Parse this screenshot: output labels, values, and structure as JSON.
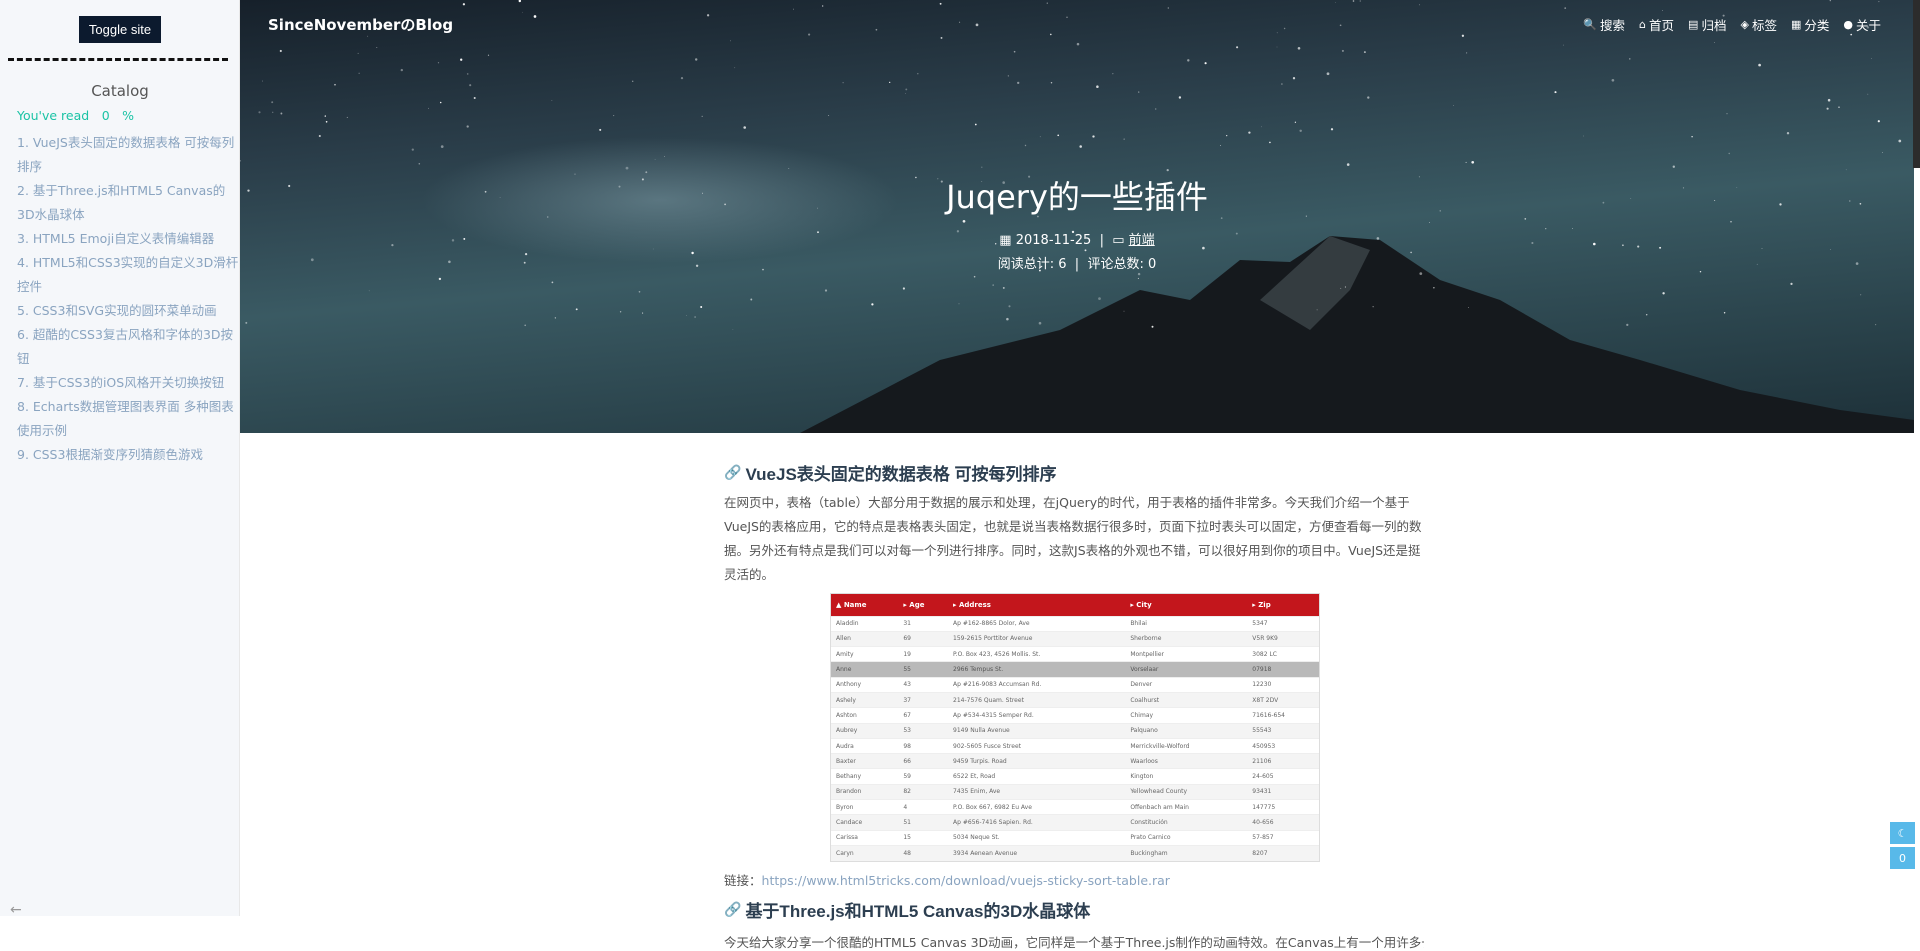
{
  "sidebar": {
    "toggle_label": "Toggle site",
    "catalog_title": "Catalog",
    "read_progress": "You've read　0　%",
    "toc": [
      "1. VueJS表头固定的数据表格 可按每列排序",
      "2. 基于Three.js和HTML5 Canvas的3D水晶球体",
      "3. HTML5 Emoji自定义表情编辑器",
      "4. HTML5和CSS3实现的自定义3D滑杆控件",
      "5. CSS3和SVG实现的圆环菜单动画",
      "6. 超酷的CSS3复古风格和字体的3D按钮",
      "7. 基于CSS3的iOS风格开关切换按钮",
      "8. Echarts数据管理图表界面 多种图表使用示例",
      "9. CSS3根据渐变序列猜颜色游戏"
    ]
  },
  "header": {
    "brand": "SinceNovemberのBlog",
    "nav": [
      {
        "icon": "search-icon",
        "glyph": "🔍",
        "label": "搜索"
      },
      {
        "icon": "home-icon",
        "glyph": "⌂",
        "label": "首页"
      },
      {
        "icon": "archive-icon",
        "glyph": "▤",
        "label": "归档"
      },
      {
        "icon": "tag-icon",
        "glyph": "◈",
        "label": "标签"
      },
      {
        "icon": "category-icon",
        "glyph": "▦",
        "label": "分类"
      },
      {
        "icon": "user-icon",
        "glyph": "●",
        "label": "关于"
      }
    ]
  },
  "post": {
    "title": "Juqery的一些插件",
    "date": "2018-11-25",
    "category": "前端",
    "views_label": "阅读总计: 6",
    "comments_label": "评论总数: 0"
  },
  "section1": {
    "heading": "VueJS表头固定的数据表格 可按每列排序",
    "paragraph": "在网页中，表格（table）大部分用于数据的展示和处理，在jQuery的时代，用于表格的插件非常多。今天我们介绍一个基于VueJS的表格应用，它的特点是表格表头固定，也就是说当表格数据行很多时，页面下拉时表头可以固定，方便查看每一列的数据。另外还有特点是我们可以对每一个列进行排序。同时，这款JS表格的外观也不错，可以很好用到你的项目中。VueJS还是挺灵活的。",
    "table": {
      "headers": [
        "▲ Name",
        "▸ Age",
        "▸ Address",
        "▸ City",
        "▸ Zip"
      ],
      "rows": [
        [
          "Aladdin",
          "31",
          "Ap #162-8865 Dolor, Ave",
          "Bhilai",
          "5347"
        ],
        [
          "Allen",
          "69",
          "159-2615 Porttitor Avenue",
          "Sherborne",
          "V5R 9K9"
        ],
        [
          "Amity",
          "19",
          "P.O. Box 423, 4526 Mollis. St.",
          "Montpellier",
          "3082 LC"
        ],
        [
          "Anne",
          "55",
          "2966 Tempus St.",
          "Vorselaar",
          "07918"
        ],
        [
          "Anthony",
          "43",
          "Ap #216-9083 Accumsan Rd.",
          "Denver",
          "12230"
        ],
        [
          "Ashely",
          "37",
          "214-7576 Quam. Street",
          "Coalhurst",
          "X8T 2DV"
        ],
        [
          "Ashton",
          "67",
          "Ap #534-4315 Semper Rd.",
          "Chimay",
          "71616-654"
        ],
        [
          "Aubrey",
          "53",
          "9149 Nulla Avenue",
          "Palquano",
          "55543"
        ],
        [
          "Audra",
          "98",
          "902-5605 Fusce Street",
          "Merrickville-Wolford",
          "450953"
        ],
        [
          "Baxter",
          "66",
          "9459 Turpis. Road",
          "Waarloos",
          "21106"
        ],
        [
          "Bethany",
          "59",
          "6522 Et, Road",
          "Kington",
          "24-605"
        ],
        [
          "Brandon",
          "82",
          "7435 Enim, Ave",
          "Yellowhead County",
          "93431"
        ],
        [
          "Byron",
          "4",
          "P.O. Box 667, 6982 Eu Ave",
          "Offenbach am Main",
          "147775"
        ],
        [
          "Candace",
          "51",
          "Ap #656-7416 Sapien. Rd.",
          "Constitución",
          "40-656"
        ],
        [
          "Carissa",
          "15",
          "5034 Neque St.",
          "Prato Carnico",
          "57-857"
        ],
        [
          "Caryn",
          "48",
          "3934 Aenean Avenue",
          "Buckingham",
          "8207"
        ]
      ]
    },
    "link_label": "链接：",
    "link_url": "https://www.html5tricks.com/download/vuejs-sticky-sort-table.rar"
  },
  "section2": {
    "heading": "基于Three.js和HTML5 Canvas的3D水晶球体",
    "paragraph": "今天给大家分享一个很酷的HTML5 Canvas 3D动画，它同样是一个基于Three.js制作的动画特效。在Canvas上有一个用许多长度各"
  },
  "right_tools": {
    "mode_icon": "moon-icon",
    "mode_glyph": "☾",
    "counter": "0"
  },
  "colors": {
    "toc_link": "#8aa4c0",
    "read_text": "#1bc3a5",
    "table_header": "#c3161c",
    "tool_bg": "#58b9e9"
  }
}
